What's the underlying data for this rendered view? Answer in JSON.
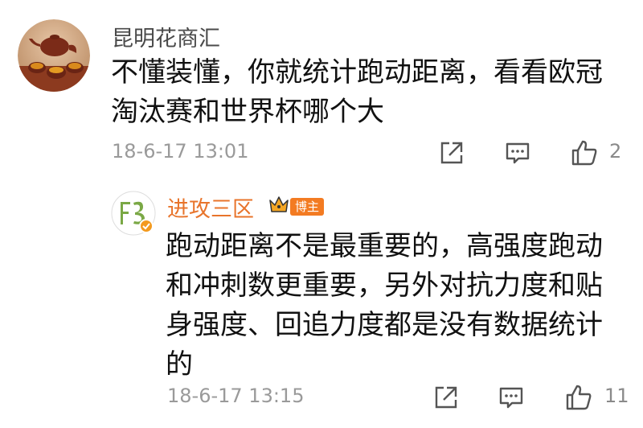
{
  "comment": {
    "username": "昆明花商汇",
    "avatar_icon": "teapot-avatar-icon",
    "text": "不懂装懂，你就统计跑动距离，看看欧冠淘汰赛和世界杯哪个大",
    "time": "18-6-17 13:01",
    "likes": "2",
    "icons": {
      "forward": "forward-icon",
      "reply": "reply-icon",
      "like": "thumb-up-icon"
    }
  },
  "reply": {
    "username": "进攻三区",
    "avatar_icon": "f3-logo-avatar-icon",
    "crown_icon": "crown-icon",
    "badge": "博主",
    "text": "跑动距离不是最重要的，高强度跑动和冲刺数更重要，另外对抗力度和贴身强度、回追力度都是没有数据统计的",
    "time": "18-6-17 13:15",
    "likes": "11",
    "icons": {
      "forward": "forward-icon",
      "reply": "reply-icon",
      "like": "thumb-up-icon"
    }
  },
  "colors": {
    "reply_username": "#e8742b",
    "badge": "#f37b22",
    "meta_text": "#9a9a9a"
  }
}
